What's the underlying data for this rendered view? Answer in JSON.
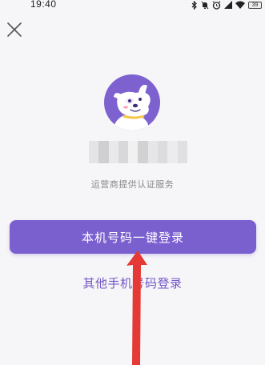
{
  "status_bar": {
    "time": "19:40",
    "icons": [
      "bluetooth-icon",
      "mute-bell-icon",
      "alarm-icon",
      "signal-icon",
      "wifi-icon"
    ],
    "battery": "39"
  },
  "close_icon": "close-icon",
  "avatar": {
    "icon": "dog-mascot-icon",
    "color": "#7d62cf"
  },
  "phone_number_masked": "",
  "provider_text": "运营商提供认证服务",
  "primary_login": {
    "label": "本机号码一键登录",
    "color": "#7a5fcf"
  },
  "other_login": {
    "label": "其他手机号码登录",
    "color": "#7357c7"
  },
  "annotation": {
    "icon": "red-arrow-icon",
    "color": "#e53935"
  }
}
